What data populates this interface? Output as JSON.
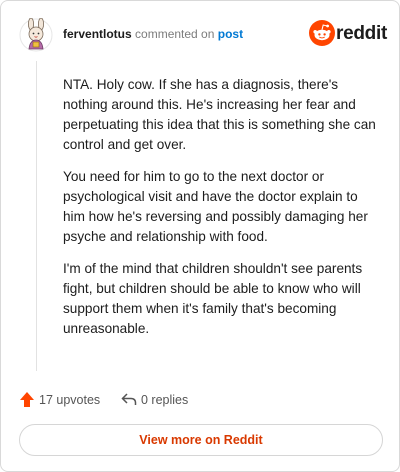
{
  "header": {
    "username": "ferventlotus",
    "action_text": "commented on",
    "target_link": "post",
    "brand": "reddit"
  },
  "comment": {
    "paragraphs": [
      "NTA. Holy cow. If she has a diagnosis, there's nothing around this. He's increasing her fear and perpetuating this idea that this is something she can control and get over.",
      "You need for him to go to the next doctor or psychological visit and have the doctor explain to him how he's reversing and possibly damaging her psyche and relationship with food.",
      "I'm of the mind that children shouldn't see parents fight, but children should be able to know who will support them when it's family that's becoming unreasonable."
    ]
  },
  "actions": {
    "upvotes_label": "17 upvotes",
    "replies_label": "0 replies"
  },
  "footer": {
    "view_more_label": "View more on Reddit"
  },
  "colors": {
    "accent": "#ff4500",
    "link": "#0079d3",
    "cta_text": "#d93900"
  },
  "icons": {
    "avatar": "avatar-icon",
    "brand": "reddit-alien-icon",
    "upvote": "upvote-arrow-icon",
    "reply": "reply-arrow-icon"
  }
}
